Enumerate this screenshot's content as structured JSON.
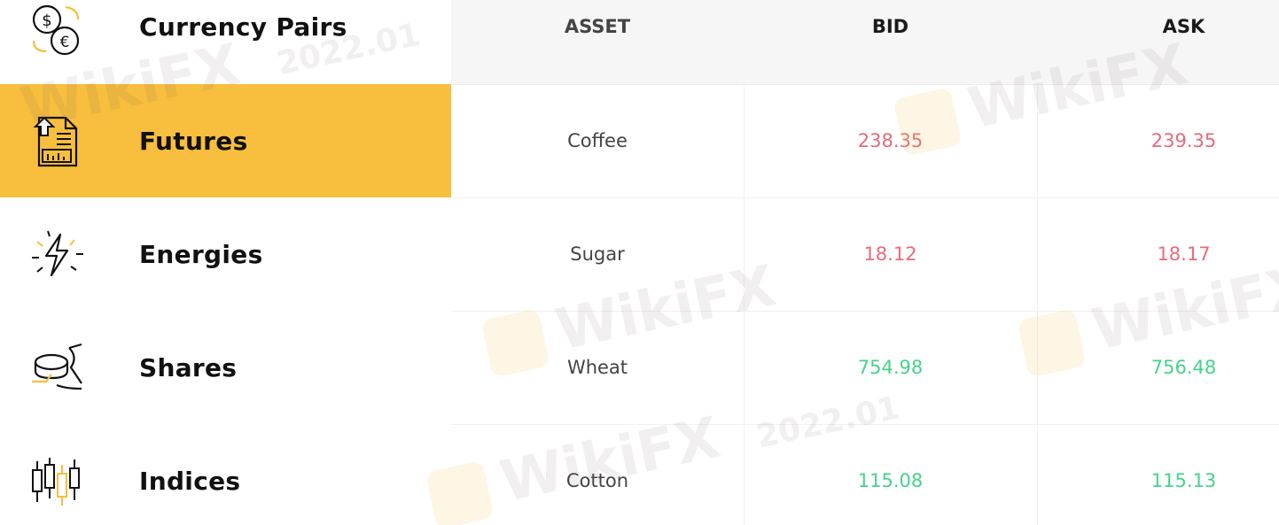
{
  "nav": {
    "items": [
      {
        "label": "Currency Pairs",
        "icon": "currency-exchange-icon"
      },
      {
        "label": "Futures",
        "icon": "futures-document-icon",
        "active": true
      },
      {
        "label": "Energies",
        "icon": "lightning-icon"
      },
      {
        "label": "Shares",
        "icon": "shares-coins-icon"
      },
      {
        "label": "Indices",
        "icon": "candlestick-icon"
      }
    ]
  },
  "table": {
    "headers": {
      "asset": "ASSET",
      "bid": "BID",
      "ask": "ASK"
    },
    "rows": [
      {
        "asset": "Coffee",
        "bid": "238.35",
        "ask": "239.35",
        "trend": "down"
      },
      {
        "asset": "Sugar",
        "bid": "18.12",
        "ask": "18.17",
        "trend": "down"
      },
      {
        "asset": "Wheat",
        "bid": "754.98",
        "ask": "756.48",
        "trend": "up"
      },
      {
        "asset": "Cotton",
        "bid": "115.08",
        "ask": "115.13",
        "trend": "up"
      }
    ]
  },
  "watermark": {
    "brand": "WikiFX",
    "date": "2022.01"
  },
  "colors": {
    "accent": "#f8be3d",
    "down": "#e76b7b",
    "up": "#45d38a"
  }
}
